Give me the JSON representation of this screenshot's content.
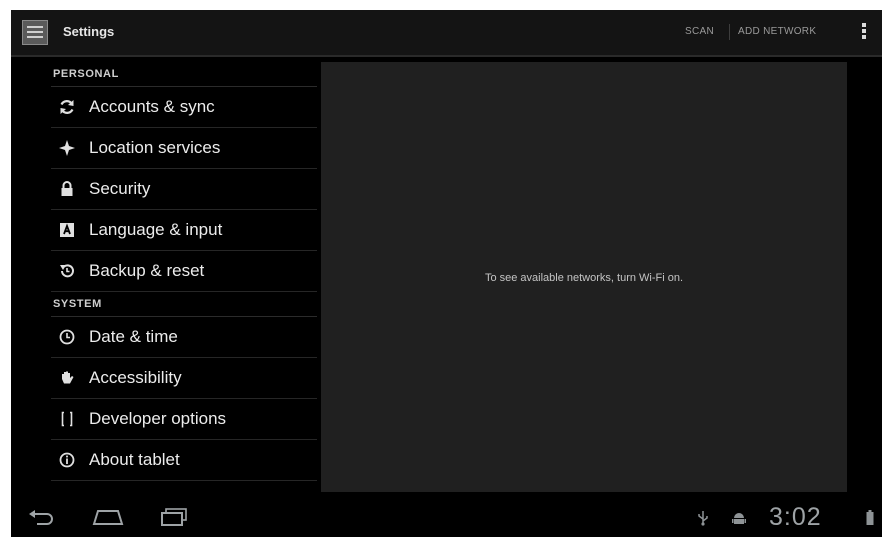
{
  "app": {
    "title": "Settings"
  },
  "actions": {
    "scan": "SCAN",
    "add_network": "ADD NETWORK"
  },
  "sidebar": {
    "categories": [
      {
        "label": "PERSONAL",
        "items": [
          {
            "label": "Accounts & sync",
            "icon": "sync-icon"
          },
          {
            "label": "Location services",
            "icon": "location-icon"
          },
          {
            "label": "Security",
            "icon": "lock-icon"
          },
          {
            "label": "Language & input",
            "icon": "keyboard-icon"
          },
          {
            "label": "Backup & reset",
            "icon": "backup-icon"
          }
        ]
      },
      {
        "label": "SYSTEM",
        "items": [
          {
            "label": "Date & time",
            "icon": "clock-icon"
          },
          {
            "label": "Accessibility",
            "icon": "hand-icon"
          },
          {
            "label": "Developer options",
            "icon": "braces-icon"
          },
          {
            "label": "About tablet",
            "icon": "info-icon"
          }
        ]
      }
    ]
  },
  "detail": {
    "message": "To see available networks, turn Wi-Fi on."
  },
  "status": {
    "time": "3:02"
  },
  "colors": {
    "background": "#000000",
    "panel": "#202020",
    "text": "#ececec",
    "clock": "#9ea3a6"
  }
}
